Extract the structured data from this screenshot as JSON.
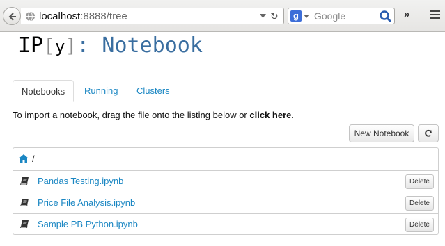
{
  "browser": {
    "url_host": "localhost",
    "url_rest": ":8888/tree",
    "search_placeholder": "Google",
    "overflow_label": "»"
  },
  "header": {
    "logo_ip": "IP",
    "logo_bracket_open": "[",
    "logo_y": "y",
    "logo_bracket_close": "]",
    "logo_colon": ":",
    "logo_notebook": "Notebook"
  },
  "tabs": [
    {
      "label": "Notebooks",
      "active": true
    },
    {
      "label": "Running",
      "active": false
    },
    {
      "label": "Clusters",
      "active": false
    }
  ],
  "instructions": {
    "text": "To import a notebook, drag the file onto the listing below or ",
    "link": "click here",
    "end": "."
  },
  "actions": {
    "new_notebook_label": "New Notebook"
  },
  "listing": {
    "path": "/",
    "notebooks": [
      {
        "name": "Pandas Testing.ipynb",
        "delete_label": "Delete"
      },
      {
        "name": "Price File Analysis.ipynb",
        "delete_label": "Delete"
      },
      {
        "name": "Sample PB Python.ipynb",
        "delete_label": "Delete"
      }
    ]
  },
  "colors": {
    "link": "#1b87c3",
    "logo_blue": "#3a6ea0"
  }
}
